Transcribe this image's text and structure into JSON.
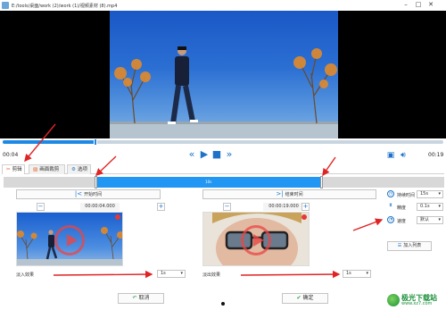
{
  "window": {
    "title": "E:/tools/桌面/work (2)/work (1)/视频素材 (8).mp4"
  },
  "player": {
    "current_time": "00:04",
    "total_time": "00:19",
    "progress": 0.21
  },
  "tabs": [
    {
      "label": "剪辑",
      "icon": "scissors-icon"
    },
    {
      "label": "画面裁剪",
      "icon": "crop-icon"
    },
    {
      "label": "选项",
      "icon": "options-icon"
    }
  ],
  "timeline": {
    "clip_label": "10s",
    "clip_start": 0.21,
    "clip_end": 0.72
  },
  "start": {
    "button_label": "开始时间",
    "time": "00:00:04.000",
    "effect_label": "淡入效果",
    "effect_value": "1s"
  },
  "end": {
    "button_label": "结束时间",
    "time": "00:00:19.000",
    "effect_label": "淡出效果",
    "effect_value": "1s"
  },
  "right_panel": {
    "duration_label": "持续时间",
    "duration_value": "15s",
    "precision_label": "精度",
    "precision_value": "0.1s",
    "speed_label": "速度",
    "speed_value": "默认",
    "add_list_label": "加入列表"
  },
  "buttons": {
    "cancel": "取消",
    "confirm": "确定"
  },
  "watermark": {
    "name": "极光下载站",
    "url": "www.xz7.com"
  },
  "colors": {
    "accent": "#1e88e5",
    "annotation": "#e02424"
  }
}
